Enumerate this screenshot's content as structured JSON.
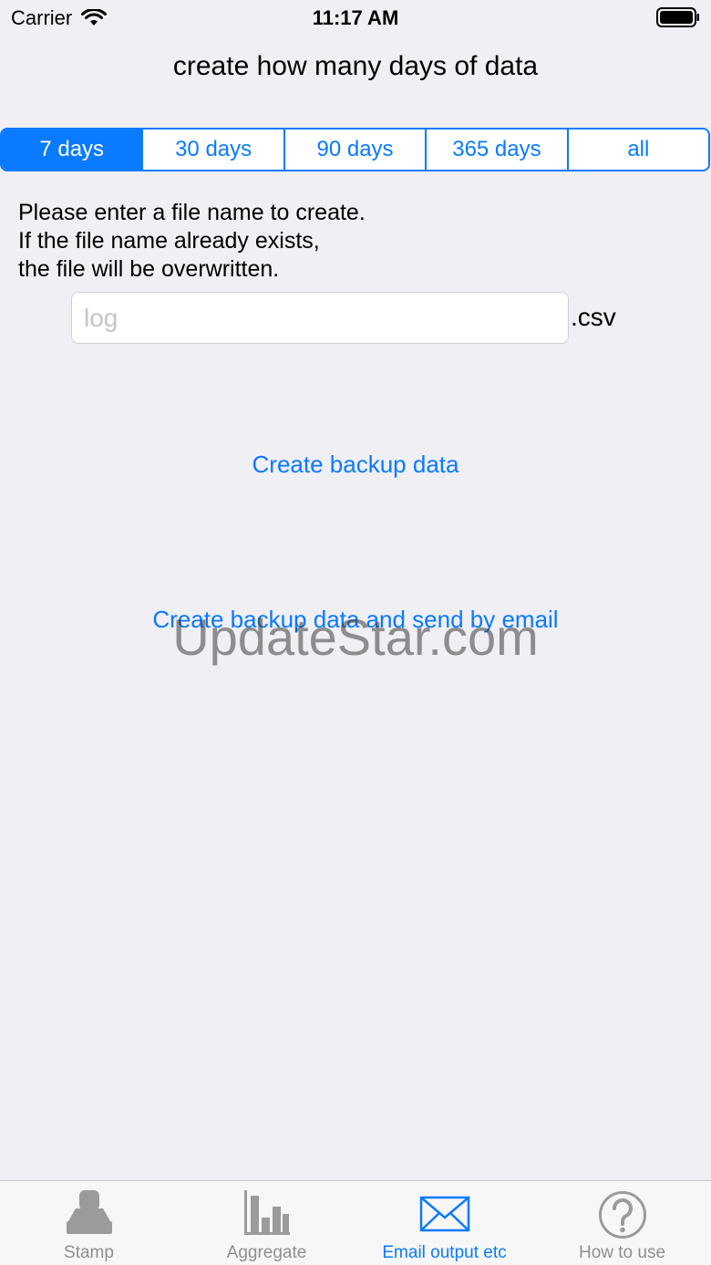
{
  "status_bar": {
    "carrier": "Carrier",
    "time": "11:17 AM"
  },
  "title": "create how many days of data",
  "segments": {
    "items": [
      "7 days",
      "30 days",
      "90 days",
      "365 days",
      "all"
    ],
    "selected_index": 0
  },
  "instructions": {
    "line1": "Please enter a file name to create.",
    "line2": "If the file name already exists,",
    "line3": "the file will be overwritten."
  },
  "filename": {
    "value": "",
    "placeholder": "log",
    "extension": ".csv"
  },
  "actions": {
    "create_backup": "Create backup data",
    "create_backup_email": "Create backup data and send by email"
  },
  "watermark": "UpdateStar.com",
  "tab_bar": {
    "items": [
      {
        "label": "Stamp",
        "icon": "stamp-icon"
      },
      {
        "label": "Aggregate",
        "icon": "bar-chart-icon"
      },
      {
        "label": "Email output etc",
        "icon": "envelope-icon"
      },
      {
        "label": "How to use",
        "icon": "question-circle-icon"
      }
    ],
    "active_index": 2
  },
  "colors": {
    "accent": "#0a7aff",
    "background": "#efeff4",
    "inactive": "#8e8e93"
  }
}
